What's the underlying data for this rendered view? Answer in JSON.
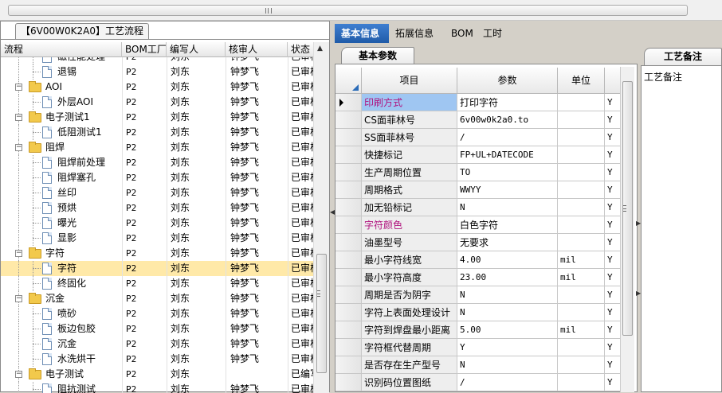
{
  "left_panel": {
    "tab_label": "【6V00W0K2A0】工艺流程",
    "columns": [
      "流程",
      "BOM工厂",
      "编写人",
      "核审人",
      "状态"
    ],
    "rows": [
      {
        "level": 2,
        "type": "doc",
        "name": "磁性能处理",
        "bom": "P2",
        "writer": "刘东",
        "reviewer": "钟梦飞",
        "status": "已审核"
      },
      {
        "level": 2,
        "type": "doc",
        "name": "退锡",
        "bom": "P2",
        "writer": "刘东",
        "reviewer": "钟梦飞",
        "status": "已审核"
      },
      {
        "level": 1,
        "type": "folder",
        "name": "AOI",
        "bom": "P2",
        "writer": "刘东",
        "reviewer": "钟梦飞",
        "status": "已审核"
      },
      {
        "level": 2,
        "type": "doc",
        "name": "外层AOI",
        "bom": "P2",
        "writer": "刘东",
        "reviewer": "钟梦飞",
        "status": "已审核"
      },
      {
        "level": 1,
        "type": "folder",
        "name": "电子测试1",
        "bom": "P2",
        "writer": "刘东",
        "reviewer": "钟梦飞",
        "status": "已审核"
      },
      {
        "level": 2,
        "type": "doc",
        "name": "低阻测试1",
        "bom": "P2",
        "writer": "刘东",
        "reviewer": "钟梦飞",
        "status": "已审核"
      },
      {
        "level": 1,
        "type": "folder",
        "name": "阻焊",
        "bom": "P2",
        "writer": "刘东",
        "reviewer": "钟梦飞",
        "status": "已审核"
      },
      {
        "level": 2,
        "type": "doc",
        "name": "阻焊前处理",
        "bom": "P2",
        "writer": "刘东",
        "reviewer": "钟梦飞",
        "status": "已审核"
      },
      {
        "level": 2,
        "type": "doc",
        "name": "阻焊塞孔",
        "bom": "P2",
        "writer": "刘东",
        "reviewer": "钟梦飞",
        "status": "已审核"
      },
      {
        "level": 2,
        "type": "doc",
        "name": "丝印",
        "bom": "P2",
        "writer": "刘东",
        "reviewer": "钟梦飞",
        "status": "已审核"
      },
      {
        "level": 2,
        "type": "doc",
        "name": "预烘",
        "bom": "P2",
        "writer": "刘东",
        "reviewer": "钟梦飞",
        "status": "已审核"
      },
      {
        "level": 2,
        "type": "doc",
        "name": "曝光",
        "bom": "P2",
        "writer": "刘东",
        "reviewer": "钟梦飞",
        "status": "已审核"
      },
      {
        "level": 2,
        "type": "doc",
        "name": "显影",
        "bom": "P2",
        "writer": "刘东",
        "reviewer": "钟梦飞",
        "status": "已审核"
      },
      {
        "level": 1,
        "type": "folder",
        "name": "字符",
        "bom": "P2",
        "writer": "刘东",
        "reviewer": "钟梦飞",
        "status": "已审核"
      },
      {
        "level": 2,
        "type": "doc",
        "name": "字符",
        "bom": "P2",
        "writer": "刘东",
        "reviewer": "钟梦飞",
        "status": "已审核",
        "selected": true
      },
      {
        "level": 2,
        "type": "doc",
        "name": "终固化",
        "bom": "P2",
        "writer": "刘东",
        "reviewer": "钟梦飞",
        "status": "已审核"
      },
      {
        "level": 1,
        "type": "folder",
        "name": "沉金",
        "bom": "P2",
        "writer": "刘东",
        "reviewer": "钟梦飞",
        "status": "已审核"
      },
      {
        "level": 2,
        "type": "doc",
        "name": "喷砂",
        "bom": "P2",
        "writer": "刘东",
        "reviewer": "钟梦飞",
        "status": "已审核"
      },
      {
        "level": 2,
        "type": "doc",
        "name": "板边包胶",
        "bom": "P2",
        "writer": "刘东",
        "reviewer": "钟梦飞",
        "status": "已审核"
      },
      {
        "level": 2,
        "type": "doc",
        "name": "沉金",
        "bom": "P2",
        "writer": "刘东",
        "reviewer": "钟梦飞",
        "status": "已审核"
      },
      {
        "level": 2,
        "type": "doc",
        "name": "水洗烘干",
        "bom": "P2",
        "writer": "刘东",
        "reviewer": "钟梦飞",
        "status": "已审核"
      },
      {
        "level": 1,
        "type": "folder",
        "name": "电子测试",
        "bom": "P2",
        "writer": "刘东",
        "reviewer": "",
        "status": "已编写"
      },
      {
        "level": 2,
        "type": "doc",
        "name": "阻抗测试",
        "bom": "P2",
        "writer": "刘东",
        "reviewer": "钟梦飞",
        "status": "已审核"
      }
    ]
  },
  "main_tabs": [
    {
      "label": "基本信息",
      "active": true
    },
    {
      "label": "拓展信息",
      "active": false
    },
    {
      "label": "BOM",
      "active": false
    },
    {
      "label": "工时",
      "active": false
    }
  ],
  "sub_tab_label": "基本参数",
  "grid": {
    "columns": [
      "项目",
      "参数",
      "单位",
      ""
    ],
    "rows": [
      {
        "name": "印刷方式",
        "value": "打印字符",
        "unit": "",
        "flag": "Y",
        "style": "highlight",
        "current": true
      },
      {
        "name": "CS面菲林号",
        "value": "6v00w0k2a0.to",
        "unit": "",
        "flag": "Y"
      },
      {
        "name": "SS面菲林号",
        "value": "/",
        "unit": "",
        "flag": "Y"
      },
      {
        "name": "快捷标记",
        "value": "FP+UL+DATECODE",
        "unit": "",
        "flag": "Y"
      },
      {
        "name": "生产周期位置",
        "value": "TO",
        "unit": "",
        "flag": "Y"
      },
      {
        "name": "周期格式",
        "value": "WWYY",
        "unit": "",
        "flag": "Y"
      },
      {
        "name": "加无铅标记",
        "value": "N",
        "unit": "",
        "flag": "Y"
      },
      {
        "name": "字符颜色",
        "value": "白色字符",
        "unit": "",
        "flag": "Y",
        "style": "pink"
      },
      {
        "name": "油墨型号",
        "value": "无要求",
        "unit": "",
        "flag": "Y"
      },
      {
        "name": "最小字符线宽",
        "value": "4.00",
        "unit": "mil",
        "flag": "Y"
      },
      {
        "name": "最小字符高度",
        "value": "23.00",
        "unit": "mil",
        "flag": "Y"
      },
      {
        "name": "周期是否为阴字",
        "value": "N",
        "unit": "",
        "flag": "Y"
      },
      {
        "name": "字符上表面处理设计",
        "value": "N",
        "unit": "",
        "flag": "Y"
      },
      {
        "name": "字符到焊盘最小距离",
        "value": "5.00",
        "unit": "mil",
        "flag": "Y"
      },
      {
        "name": "字符框代替周期",
        "value": "Y",
        "unit": "",
        "flag": "Y"
      },
      {
        "name": "是否存在生产型号",
        "value": "N",
        "unit": "",
        "flag": "Y"
      },
      {
        "name": "识别码位置图纸",
        "value": "/",
        "unit": "",
        "flag": "Y"
      }
    ]
  },
  "right_panel": {
    "tab_label": "工艺备注",
    "label": "工艺备注"
  }
}
